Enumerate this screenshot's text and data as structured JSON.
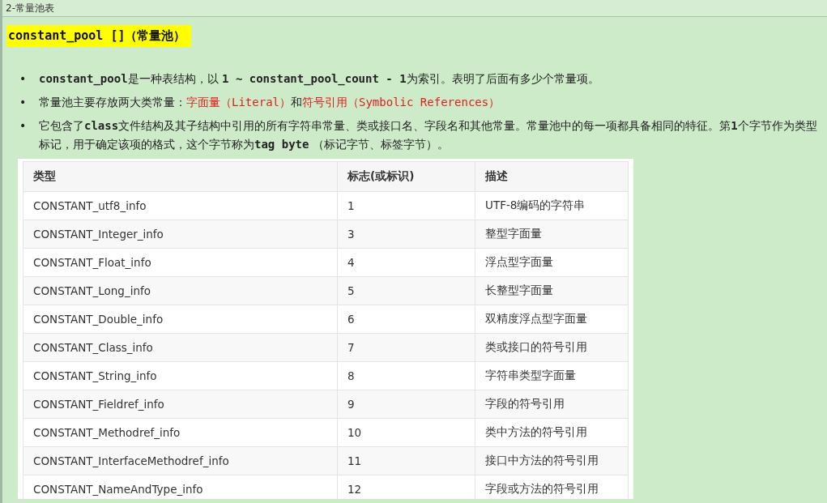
{
  "window": {
    "title": "2-常量池表"
  },
  "heading": "constant_pool []（常量池）",
  "bullets": [
    {
      "marker": "•",
      "segments": [
        {
          "kind": "code",
          "text": "constant_pool"
        },
        {
          "kind": "plain",
          "text": "是一种表结构，以 "
        },
        {
          "kind": "code",
          "text": "1 ~ constant_pool_count - 1"
        },
        {
          "kind": "plain",
          "text": "为索引。表明了后面有多少个常量项。"
        }
      ]
    },
    {
      "marker": "•",
      "segments": [
        {
          "kind": "plain",
          "text": "常量池主要存放两大类常量："
        },
        {
          "kind": "red",
          "text": "字面量（Literal）"
        },
        {
          "kind": "plain",
          "text": "和"
        },
        {
          "kind": "red",
          "text": "符号引用（Symbolic References）"
        }
      ]
    },
    {
      "marker": "•",
      "segments": [
        {
          "kind": "plain",
          "text": "它包含了"
        },
        {
          "kind": "code",
          "text": "class"
        },
        {
          "kind": "plain",
          "text": "文件结构及其子结构中引用的所有字符串常量、类或接口名、字段名和其他常量。常量池中的每一项都具备相同的特征。第"
        },
        {
          "kind": "code",
          "text": "1"
        },
        {
          "kind": "plain",
          "text": "个字节作为类型标记，用于确定该项的格式，这个字节称为"
        },
        {
          "kind": "code",
          "text": "tag byte"
        },
        {
          "kind": "plain",
          "text": " （标记字节、标签字节）。"
        }
      ]
    }
  ],
  "table": {
    "columns": [
      "类型",
      "标志(或标识)",
      "描述"
    ],
    "rows": [
      [
        "CONSTANT_utf8_info",
        "1",
        "UTF-8编码的字符串"
      ],
      [
        "CONSTANT_Integer_info",
        "3",
        "整型字面量"
      ],
      [
        "CONSTANT_Float_info",
        "4",
        "浮点型字面量"
      ],
      [
        "CONSTANT_Long_info",
        "5",
        "长整型字面量"
      ],
      [
        "CONSTANT_Double_info",
        "6",
        "双精度浮点型字面量"
      ],
      [
        "CONSTANT_Class_info",
        "7",
        "类或接口的符号引用"
      ],
      [
        "CONSTANT_String_info",
        "8",
        "字符串类型字面量"
      ],
      [
        "CONSTANT_Fieldref_info",
        "9",
        "字段的符号引用"
      ],
      [
        "CONSTANT_Methodref_info",
        "10",
        "类中方法的符号引用"
      ],
      [
        "CONSTANT_InterfaceMethodref_info",
        "11",
        "接口中方法的符号引用"
      ],
      [
        "CONSTANT_NameAndType_info",
        "12",
        "字段或方法的符号引用"
      ]
    ]
  }
}
